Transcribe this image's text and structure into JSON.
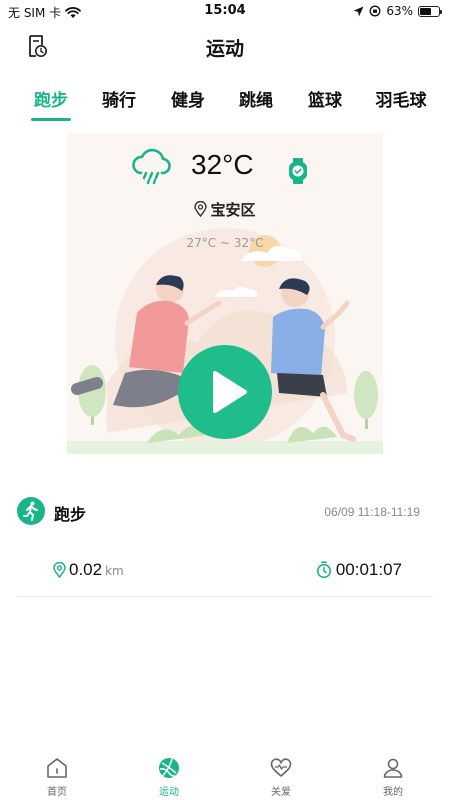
{
  "status_bar": {
    "carrier": "无 SIM 卡",
    "time": "15:04",
    "battery": "63%",
    "battery_level": 0.63
  },
  "header": {
    "title": "运动",
    "history_icon": "history-clock-icon"
  },
  "tabs": [
    {
      "label": "跑步",
      "active": true
    },
    {
      "label": "骑行"
    },
    {
      "label": "健身"
    },
    {
      "label": "跳绳"
    },
    {
      "label": "篮球"
    },
    {
      "label": "羽毛球"
    }
  ],
  "card": {
    "temperature": "32°C",
    "location": "宝安区",
    "temp_range": "27°C ~ 32°C",
    "weather_icon": "rain-cloud-icon",
    "watch_icon": "smartwatch-icon",
    "play_icon": "play-icon"
  },
  "record": {
    "title": "跑步",
    "time_range": "06/09 11:18-11:19",
    "distance": "0.02",
    "distance_unit": "km",
    "duration": "00:01:07"
  },
  "bottom_nav": [
    {
      "label": "首页",
      "icon": "home-icon"
    },
    {
      "label": "运动",
      "icon": "sport-ball-icon",
      "active": true
    },
    {
      "label": "关爱",
      "icon": "heart-icon"
    },
    {
      "label": "我的",
      "icon": "user-icon"
    }
  ],
  "colors": {
    "accent": "#19b48a",
    "card_bg": "#fbf6f1"
  }
}
